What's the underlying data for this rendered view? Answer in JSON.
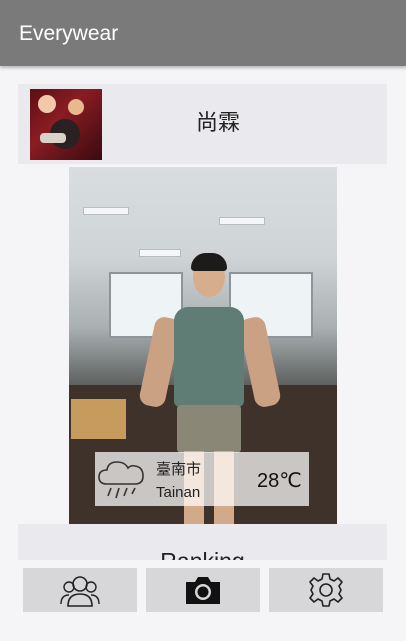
{
  "app": {
    "title": "Everywear"
  },
  "profile": {
    "name": "尚霖"
  },
  "weather": {
    "city_zh": "臺南市",
    "city_en": "Tainan",
    "temperature": "28℃",
    "icon": "rain-cloud-icon"
  },
  "ranking": {
    "label": "Ranking"
  },
  "bottom_nav": {
    "items": [
      {
        "icon": "friends-icon"
      },
      {
        "icon": "camera-icon"
      },
      {
        "icon": "gear-icon"
      }
    ]
  }
}
